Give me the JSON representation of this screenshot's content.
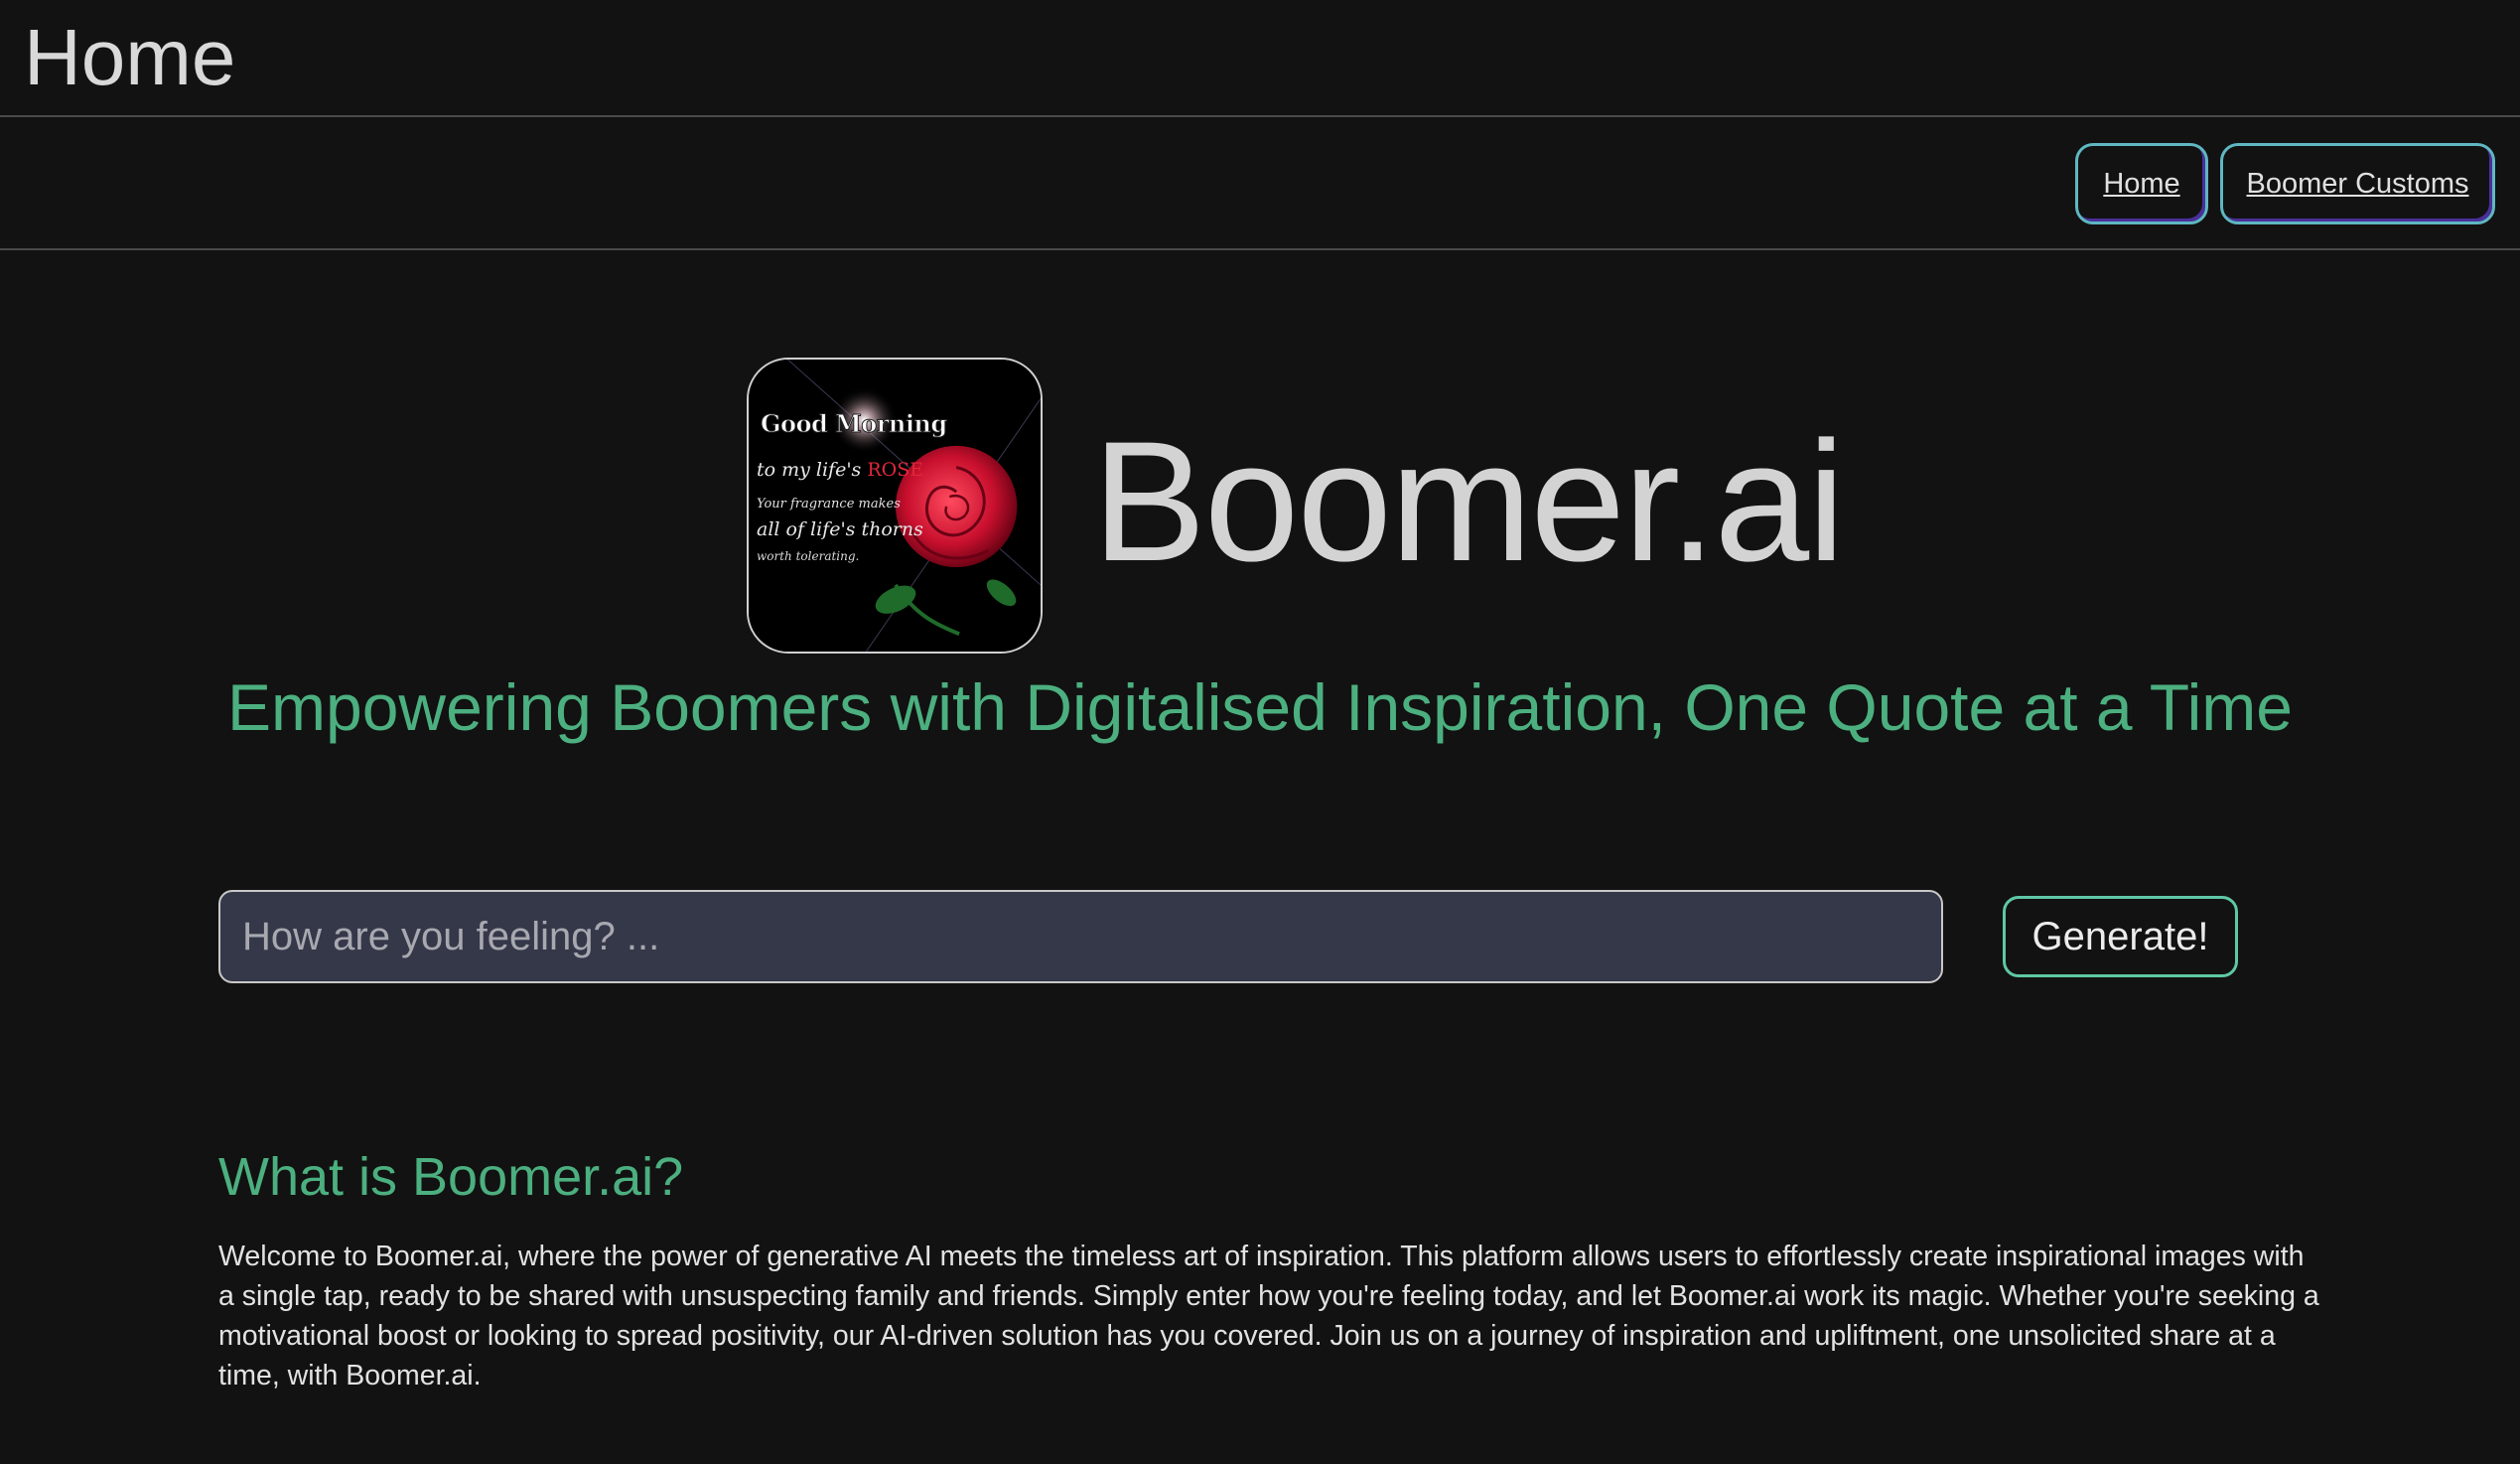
{
  "header": {
    "title": "Home"
  },
  "nav": {
    "home_label": "Home",
    "customs_label": "Boomer Customs"
  },
  "hero": {
    "brand": "Boomer.ai",
    "tagline": "Empowering Boomers with Digitalised Inspiration, One Quote at a Time",
    "logo": {
      "line1": "Good Morning",
      "line2a": "to my life's ",
      "line2b": "ROSE",
      "line3": "Your fragrance makes",
      "line4": "all of life's thorns",
      "line5": "worth tolerating."
    }
  },
  "search": {
    "placeholder": "How are you feeling? ...",
    "value": "",
    "button_label": "Generate!"
  },
  "about": {
    "heading": "What is Boomer.ai?",
    "body": "Welcome to Boomer.ai, where the power of generative AI meets the timeless art of inspiration. This platform allows users to effortlessly create inspirational images with a single tap, ready to be shared with unsuspecting family and friends. Simply enter how you're feeling today, and let Boomer.ai work its magic. Whether you're seeking a motivational boost or looking to spread positivity, our AI-driven solution has you covered. Join us on a journey of inspiration and upliftment, one unsolicited share at a time, with Boomer.ai."
  },
  "colors": {
    "background": "#121212",
    "accent_green": "#4caf7f",
    "input_bg": "#353849",
    "nav_border": "#5fb7c2",
    "button_border": "#5fc7a6",
    "rose_red": "#c8102e"
  }
}
